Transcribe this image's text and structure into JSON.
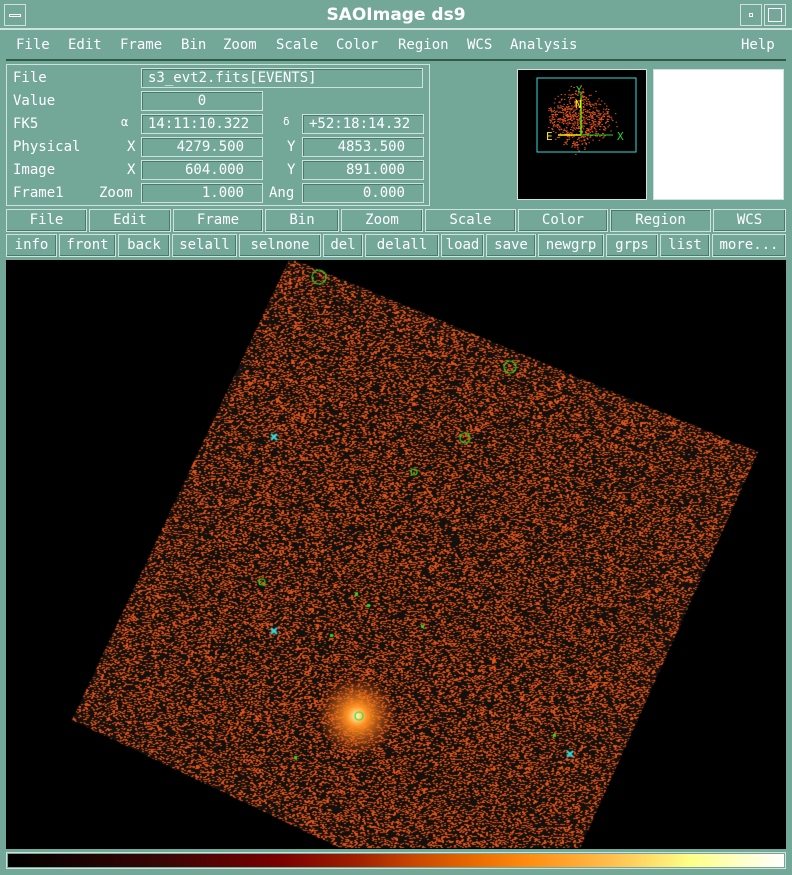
{
  "window": {
    "title": "SAOImage ds9"
  },
  "menu": [
    "File",
    "Edit",
    "Frame",
    "Bin",
    "Zoom",
    "Scale",
    "Color",
    "Region",
    "WCS",
    "Analysis"
  ],
  "help": "Help",
  "info": {
    "file_label": "File",
    "file": "s3_evt2.fits[EVENTS]",
    "value_label": "Value",
    "value": "0",
    "fk5_label": "FK5",
    "alpha": "α",
    "ra": "14:11:10.322",
    "delta": "δ",
    "dec": "+52:18:14.32",
    "physical_label": "Physical",
    "px_label": "X",
    "px": "4279.500",
    "py_label": "Y",
    "py": "4853.500",
    "image_label": "Image",
    "ix_label": "X",
    "ix": "604.000",
    "iy_label": "Y",
    "iy": "891.000",
    "frame_label": "Frame1",
    "zoom_label": "Zoom",
    "zoom": "1.000",
    "ang_label": "Ang",
    "ang": "0.000"
  },
  "panner": {
    "compass": {
      "n": "N",
      "e": "E",
      "x": "X",
      "y": "Y"
    }
  },
  "buttonbar": [
    "File",
    "Edit",
    "Frame",
    "Bin",
    "Zoom",
    "Scale",
    "Color",
    "Region",
    "WCS"
  ],
  "active_button": "Region",
  "region_buttons": [
    "info",
    "front",
    "back",
    "selall",
    "selnone",
    "del",
    "delall",
    "load",
    "save",
    "newgrp",
    "grps",
    "list",
    "more..."
  ],
  "colors": {
    "background": "#73a899",
    "events": "#e0541a",
    "region_circle": "#22dd22",
    "region_x": "#33dddd"
  }
}
